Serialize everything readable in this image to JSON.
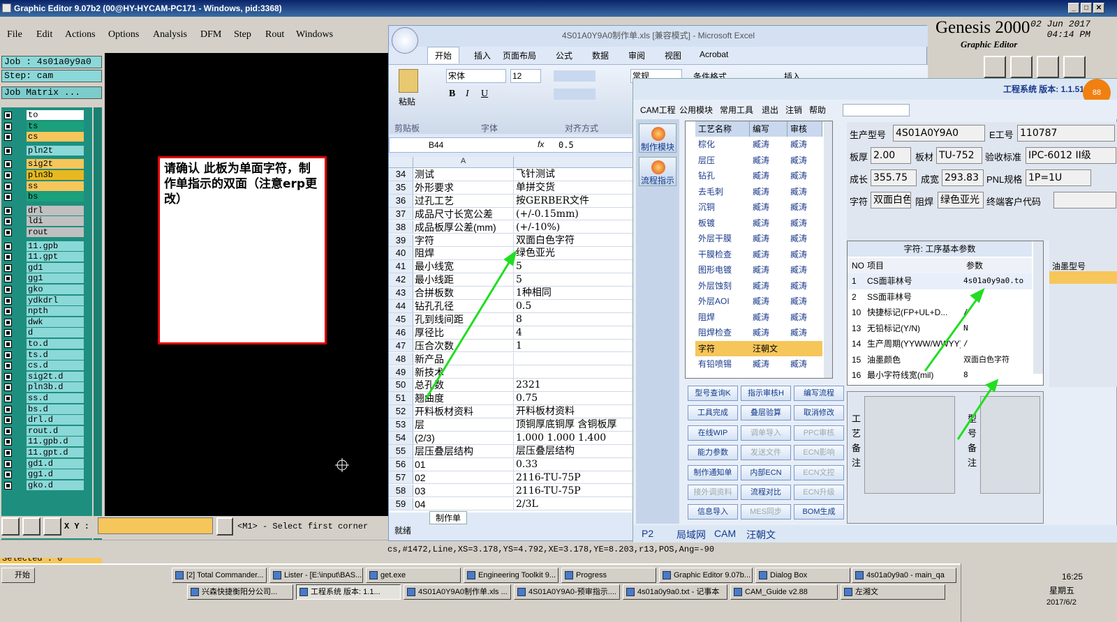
{
  "genesis": {
    "title": "Graphic Editor 9.07b2 (00@HY-HYCAM-PC171 - Windows, pid:3368)",
    "menu": [
      "File",
      "Edit",
      "Actions",
      "Options",
      "Analysis",
      "DFM",
      "Step",
      "Rout",
      "Windows"
    ],
    "brand": "Genesis 2000",
    "brand_sub": "Graphic Editor",
    "date": "02 Jun 2017",
    "time": "04:14 PM",
    "job": "Job : 4s01a0y9a0",
    "step": "Step: cam",
    "job_matrix": "Job Matrix ...",
    "layers": [
      {
        "name": "to",
        "color": "#ffffff"
      },
      {
        "name": "ts",
        "color": "#1aa07a"
      },
      {
        "name": "cs",
        "color": "#f6c65b"
      },
      {
        "name": "pln2t",
        "color": "#8ad8d8"
      },
      {
        "name": "sig2t",
        "color": "#f6c65b"
      },
      {
        "name": "pln3b",
        "color": "#e8b820"
      },
      {
        "name": "ss",
        "color": "#f6c65b"
      },
      {
        "name": "bs",
        "color": "#1aa07a"
      },
      {
        "name": "drl",
        "color": "#c0c0c0"
      },
      {
        "name": "ldi",
        "color": "#c0c0c0"
      },
      {
        "name": "rout",
        "color": "#c0c0c0"
      },
      {
        "name": "11.gpb",
        "color": "#8ad8d8"
      },
      {
        "name": "11.gpt",
        "color": "#8ad8d8"
      },
      {
        "name": "gd1",
        "color": "#8ad8d8"
      },
      {
        "name": "gg1",
        "color": "#8ad8d8"
      },
      {
        "name": "gko",
        "color": "#8ad8d8"
      },
      {
        "name": "ydkdrl",
        "color": "#8ad8d8"
      },
      {
        "name": "npth",
        "color": "#8ad8d8"
      },
      {
        "name": "dwk",
        "color": "#8ad8d8"
      },
      {
        "name": "d",
        "color": "#8ad8d8"
      },
      {
        "name": "to.d",
        "color": "#8ad8d8"
      },
      {
        "name": "ts.d",
        "color": "#8ad8d8"
      },
      {
        "name": "cs.d",
        "color": "#8ad8d8"
      },
      {
        "name": "sig2t.d",
        "color": "#8ad8d8"
      },
      {
        "name": "pln3b.d",
        "color": "#8ad8d8"
      },
      {
        "name": "ss.d",
        "color": "#8ad8d8"
      },
      {
        "name": "bs.d",
        "color": "#8ad8d8"
      },
      {
        "name": "drl.d",
        "color": "#8ad8d8"
      },
      {
        "name": "rout.d",
        "color": "#8ad8d8"
      },
      {
        "name": "11.gpb.d",
        "color": "#8ad8d8"
      },
      {
        "name": "11.gpt.d",
        "color": "#8ad8d8"
      },
      {
        "name": "gd1.d",
        "color": "#8ad8d8"
      },
      {
        "name": "gg1.d",
        "color": "#8ad8d8"
      },
      {
        "name": "gko.d",
        "color": "#8ad8d8"
      }
    ],
    "selected": "Selected : 0",
    "xy_label": "X Y :",
    "prompt": "<M1> - Select first corner",
    "status": "cs,#1472,Line,XS=3.178,YS=4.792,XE=3.178,YE=8.203,r13,POS,Ang=-90",
    "note": "请确认 此板为单面字符，制作单指示的双面（注意erp更改）"
  },
  "excel": {
    "title": "4S01A0Y9A0制作单.xls [兼容模式] - Microsoft Excel",
    "tabs": [
      "开始",
      "插入",
      "页面布局",
      "公式",
      "数据",
      "审阅",
      "视图",
      "Acrobat"
    ],
    "font_name": "宋体",
    "font_size": "12",
    "number_format": "常规",
    "groups": {
      "clipboard": "剪贴板",
      "font": "字体",
      "align": "对齐方式"
    },
    "paste": "粘贴",
    "cond_format": "条件格式",
    "insert": "插入",
    "name_box": "B44",
    "formula_value": "0.5",
    "col_a": "A",
    "rows": [
      {
        "n": "34",
        "a": "测试",
        "b": "飞针测试"
      },
      {
        "n": "35",
        "a": "外形要求",
        "b": "单拼交货"
      },
      {
        "n": "36",
        "a": "过孔工艺",
        "b": "按GERBER文件"
      },
      {
        "n": "37",
        "a": "成品尺寸长宽公差",
        "b": "(+/-0.15mm)"
      },
      {
        "n": "38",
        "a": "成品板厚公差(mm)",
        "b": "(+/-10%)"
      },
      {
        "n": "39",
        "a": "字符",
        "b": "双面白色字符"
      },
      {
        "n": "40",
        "a": "阻焊",
        "b": "绿色亚光"
      },
      {
        "n": "41",
        "a": "最小线宽",
        "b": "5"
      },
      {
        "n": "42",
        "a": "最小线距",
        "b": "5"
      },
      {
        "n": "43",
        "a": "合拼板数",
        "b": "1种相同"
      },
      {
        "n": "44",
        "a": "钻孔孔径",
        "b": "0.5"
      },
      {
        "n": "45",
        "a": "孔到线间距",
        "b": "8"
      },
      {
        "n": "46",
        "a": "厚径比",
        "b": "4"
      },
      {
        "n": "47",
        "a": "压合次数",
        "b": "1"
      },
      {
        "n": "48",
        "a": "新产品",
        "b": ""
      },
      {
        "n": "49",
        "a": "新技术",
        "b": ""
      },
      {
        "n": "50",
        "a": "总孔数",
        "b": "2321"
      },
      {
        "n": "51",
        "a": "翘曲度",
        "b": "0.75"
      },
      {
        "n": "52",
        "a": "开料板材资料",
        "b": "开料板材资料"
      },
      {
        "n": "53",
        "a": "层",
        "b": "顶铜厚底铜厚 含铜板厚"
      },
      {
        "n": "54",
        "a": "(2/3)",
        "b": "1.000  1.000   1.400"
      },
      {
        "n": "55",
        "a": "层压叠层结构",
        "b": "层压叠层结构"
      },
      {
        "n": "56",
        "a": "01",
        "b": "0.33"
      },
      {
        "n": "57",
        "a": "02",
        "b": "2116-TU-75P"
      },
      {
        "n": "58",
        "a": "03",
        "b": "2116-TU-75P"
      },
      {
        "n": "59",
        "a": "04",
        "b": "2/3L"
      }
    ],
    "sheet_tab": "制作单",
    "status": "就绪"
  },
  "eng": {
    "title": "工程系统  版本: 1.1.51.4",
    "menu": [
      "CAM工程",
      "公用模块",
      "常用工具",
      "退出",
      "注销",
      "帮助"
    ],
    "left_buttons": [
      "制作模块",
      "流程指示"
    ],
    "proc_headers": [
      "工艺名称",
      "编写",
      "审核"
    ],
    "procs": [
      {
        "name": "棕化",
        "w": "臧涛",
        "r": "臧涛"
      },
      {
        "name": "层压",
        "w": "臧涛",
        "r": "臧涛"
      },
      {
        "name": "钻孔",
        "w": "臧涛",
        "r": "臧涛"
      },
      {
        "name": "去毛刺",
        "w": "臧涛",
        "r": "臧涛"
      },
      {
        "name": "沉铜",
        "w": "臧涛",
        "r": "臧涛"
      },
      {
        "name": "板镀",
        "w": "臧涛",
        "r": "臧涛"
      },
      {
        "name": "外层干膜",
        "w": "臧涛",
        "r": "臧涛"
      },
      {
        "name": "干膜检查",
        "w": "臧涛",
        "r": "臧涛"
      },
      {
        "name": "图形电镀",
        "w": "臧涛",
        "r": "臧涛"
      },
      {
        "name": "外层蚀刻",
        "w": "臧涛",
        "r": "臧涛"
      },
      {
        "name": "外层AOI",
        "w": "臧涛",
        "r": "臧涛"
      },
      {
        "name": "阻焊",
        "w": "臧涛",
        "r": "臧涛"
      },
      {
        "name": "阻焊检查",
        "w": "臧涛",
        "r": "臧涛"
      },
      {
        "name": "字符",
        "w": "汪朝文",
        "r": ""
      },
      {
        "name": "有铅喷锡",
        "w": "臧涛",
        "r": "臧涛"
      }
    ],
    "buttons": [
      {
        "t": "型号查询K",
        "d": false
      },
      {
        "t": "指示审核H",
        "d": false
      },
      {
        "t": "编写流程",
        "d": false
      },
      {
        "t": "工具完成",
        "d": false
      },
      {
        "t": "叠层验算",
        "d": false
      },
      {
        "t": "取消修改",
        "d": false
      },
      {
        "t": "在线WIP",
        "d": false
      },
      {
        "t": "调单导入",
        "d": true
      },
      {
        "t": "PPC审核",
        "d": true
      },
      {
        "t": "能力参数",
        "d": false
      },
      {
        "t": "发送文件",
        "d": true
      },
      {
        "t": "ECN影响",
        "d": true
      },
      {
        "t": "制作通知单",
        "d": false
      },
      {
        "t": "内部ECN",
        "d": false
      },
      {
        "t": "ECN文控",
        "d": true
      },
      {
        "t": "接外调资料",
        "d": true
      },
      {
        "t": "流程对比",
        "d": false
      },
      {
        "t": "ECN升级",
        "d": true
      },
      {
        "t": "信息导入",
        "d": false
      },
      {
        "t": "MES同步",
        "d": true
      },
      {
        "t": "BOM生成",
        "d": false
      }
    ],
    "info": {
      "model_label": "生产型号",
      "model": "4S01A0Y9A0",
      "e_label": "E工号",
      "e": "110787",
      "thick_label": "板厚",
      "thick": "2.00",
      "mat_label": "板材",
      "mat": "TU-752",
      "std_label": "验收标准",
      "std": "IPC-6012 II级",
      "len_label": "成长",
      "len": "355.75",
      "wid_label": "成宽",
      "wid": "293.83",
      "pnl_label": "PNL规格",
      "pnl": "1P=1U",
      "silk_label": "字符",
      "silk": "双面白色",
      "mask_label": "阻焊",
      "mask": "绿色亚光",
      "cust_label": "终端客户代码",
      "cust": ""
    },
    "params_title": "字符: 工序基本参数",
    "params_headers": [
      "NO",
      "项目",
      "参数"
    ],
    "params": [
      {
        "no": "1",
        "item": "CS面菲林号",
        "val": "4s01a0y9a0.to"
      },
      {
        "no": "2",
        "item": "SS面菲林号",
        "val": ""
      },
      {
        "no": "10",
        "item": "快捷标记(FP+UL+D...",
        "val": "/"
      },
      {
        "no": "13",
        "item": "无铅标记(Y/N)",
        "val": "N"
      },
      {
        "no": "14",
        "item": "生产周期(YYWW/WWYY)",
        "val": "/"
      },
      {
        "no": "15",
        "item": "油墨颜色",
        "val": "双面白色字符"
      },
      {
        "no": "16",
        "item": "最小字符线宽(mil)",
        "val": "8"
      }
    ],
    "remark1": "工艺备注",
    "remark2": "型号备注",
    "ink_label": "油墨型号",
    "bottom": [
      "P2",
      "局域网",
      "CAM",
      "汪朝文"
    ]
  },
  "taskbar": {
    "start": "开始",
    "row1": [
      "[2] Total Commander...",
      "Lister - [E:\\input\\BAS...",
      "get.exe",
      "Engineering Toolkit 9...",
      "Progress",
      "Graphic Editor 9.07b...",
      "Dialog Box",
      "4s01a0y9a0 - main_qa"
    ],
    "row2": [
      "兴森快捷衡阳分公司...",
      "工程系统  版本: 1.1...",
      "4S01A0Y9A0制作单.xls ...",
      "4S01A0Y9A0-预审指示....",
      "4s01a0y9a0.txt - 记事本",
      "CAM_Guide v2.88",
      "左湘文"
    ],
    "time": "16:25",
    "weekday": "星期五",
    "date": "2017/6/2"
  }
}
